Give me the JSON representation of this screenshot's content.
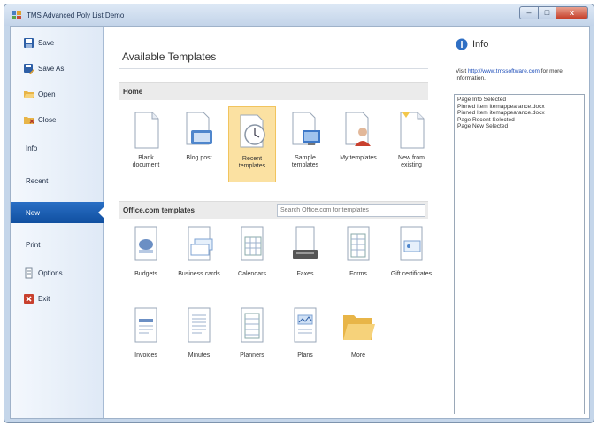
{
  "window": {
    "title": "TMS Advanced Poly List Demo",
    "controls": {
      "minimize": "–",
      "maximize": "□",
      "close": "x"
    }
  },
  "sidebar": {
    "items": [
      {
        "label": "Save",
        "icon": "save-icon",
        "selected": false
      },
      {
        "label": "Save As",
        "icon": "save-as-icon",
        "selected": false
      },
      {
        "label": "Open",
        "icon": "open-folder-icon",
        "selected": false
      },
      {
        "label": "Close",
        "icon": "close-folder-icon",
        "selected": false
      },
      {
        "label": "Info",
        "icon": null,
        "selected": false
      },
      {
        "label": "Recent",
        "icon": null,
        "selected": false
      },
      {
        "label": "New",
        "icon": null,
        "selected": true
      },
      {
        "label": "Print",
        "icon": null,
        "selected": false
      },
      {
        "label": "Options",
        "icon": "options-icon",
        "selected": false
      },
      {
        "label": "Exit",
        "icon": "exit-icon",
        "selected": false
      }
    ]
  },
  "main": {
    "title": "Available Templates",
    "home_section": {
      "label": "Home",
      "tiles": [
        {
          "label": "Blank document",
          "icon": "blank-document-icon",
          "selected": false
        },
        {
          "label": "Blog post",
          "icon": "blog-post-icon",
          "selected": false
        },
        {
          "label": "Recent templates",
          "icon": "recent-templates-icon",
          "selected": true
        },
        {
          "label": "Sample templates",
          "icon": "sample-templates-icon",
          "selected": false
        },
        {
          "label": "My templates",
          "icon": "my-templates-icon",
          "selected": false
        },
        {
          "label": "New from existing",
          "icon": "new-from-existing-icon",
          "selected": false
        }
      ]
    },
    "office_section": {
      "label": "Office.com templates",
      "search_placeholder": "Search Office.com for templates",
      "tiles": [
        {
          "label": "Budgets",
          "icon": "budgets-icon"
        },
        {
          "label": "Business cards",
          "icon": "business-cards-icon"
        },
        {
          "label": "Calendars",
          "icon": "calendars-icon"
        },
        {
          "label": "Faxes",
          "icon": "faxes-icon"
        },
        {
          "label": "Forms",
          "icon": "forms-icon"
        },
        {
          "label": "Gift certificates",
          "icon": "gift-certificates-icon"
        },
        {
          "label": "Invoices",
          "icon": "invoices-icon"
        },
        {
          "label": "Minutes",
          "icon": "minutes-icon"
        },
        {
          "label": "Planners",
          "icon": "planners-icon"
        },
        {
          "label": "Plans",
          "icon": "plans-icon"
        },
        {
          "label": "More",
          "icon": "folder-icon"
        }
      ]
    }
  },
  "info": {
    "title": "Info",
    "visit_prefix": "Visit",
    "link": "http://www.tmssoftware.com",
    "visit_suffix": "for more information.",
    "log": [
      "Page Info Selected",
      "Pinned Item itemappearance.docx",
      "Pinned Item itemappearance.docx",
      "Page Recent Selected",
      "Page New Selected"
    ]
  },
  "colors": {
    "accent": "#1a5fb4",
    "selected_tile": "#fbe1a2",
    "section_bar": "#ebebeb"
  }
}
